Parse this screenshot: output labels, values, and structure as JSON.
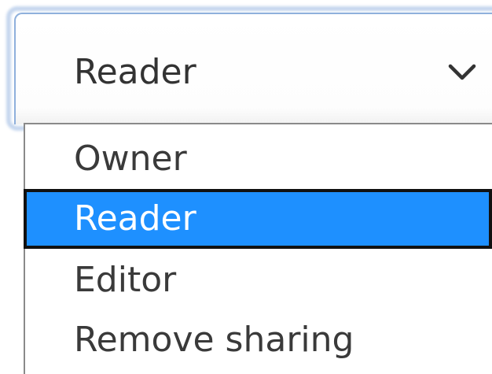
{
  "select": {
    "value": "Reader"
  },
  "options": [
    {
      "label": "Owner"
    },
    {
      "label": "Reader",
      "highlighted": true
    },
    {
      "label": "Editor"
    },
    {
      "label": "Remove sharing"
    }
  ],
  "icons": {
    "expand": "chevron-down-icon"
  },
  "colors": {
    "highlight": "#1e90ff",
    "highlight_text": "#ffffff",
    "focus_border": "#8fb0dc",
    "text": "#333333"
  }
}
